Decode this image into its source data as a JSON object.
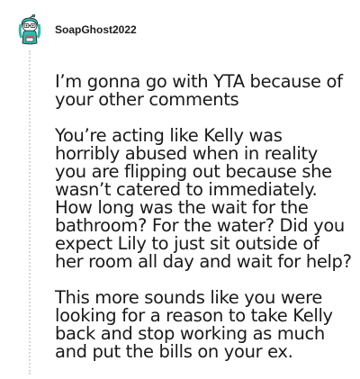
{
  "comment": {
    "author": "SoapGhost2022",
    "avatar_icon": "snoo-avatar-icon",
    "paragraphs": [
      "I’m gonna go with YTA because of your other comments",
      "You’re acting like Kelly was horribly abused when in reality you are flipping out because she wasn’t catered to immediately. How long was the wait for the bathroom? For the water? Did you expect Lily to just sit outside of her room all day and wait for help?",
      "This more sounds like you were looking for a reason to take Kelly back and stop working as much and put the bills on your ex."
    ]
  },
  "colors": {
    "background": "#ffffff",
    "text": "#1a1a1b",
    "thread_line": "#d7d9db",
    "avatar_teal": "#2fb9a9"
  }
}
